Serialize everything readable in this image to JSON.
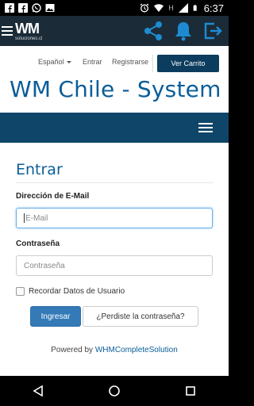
{
  "status_bar": {
    "time": "6:37",
    "network_label": "H",
    "icons": [
      "facebook-icon",
      "facebook-icon",
      "whatsapp-icon",
      "image-icon",
      "alarm-icon",
      "wifi-icon",
      "signal-icon",
      "battery-icon"
    ]
  },
  "app_bar": {
    "logo_text": "WM",
    "logo_sub": "soluciones.cl",
    "icons": [
      "menu-icon",
      "share-icon",
      "bell-icon",
      "exit-icon"
    ]
  },
  "top_nav": {
    "language": "Español",
    "login": "Entrar",
    "register": "Registrarse",
    "cart_button": "Ver Carrito"
  },
  "site": {
    "title": "WM Chile - System Ca"
  },
  "login_form": {
    "title": "Entrar",
    "email_label": "Dirección de E-Mail",
    "email_placeholder": "E-Mail",
    "password_label": "Contraseña",
    "password_placeholder": "Contraseña",
    "remember_label": "Recordar Datos de Usuario",
    "submit_button": "Ingresar",
    "forgot_button": "¿Perdiste la contraseña?"
  },
  "footer": {
    "powered_prefix": "Powered by ",
    "powered_link": "WHMCompleteSolution"
  },
  "colors": {
    "app_bar": "#1b2b38",
    "accent_blue": "#0b5d99",
    "navbar": "#0e4569",
    "primary_button": "#337ab7"
  }
}
